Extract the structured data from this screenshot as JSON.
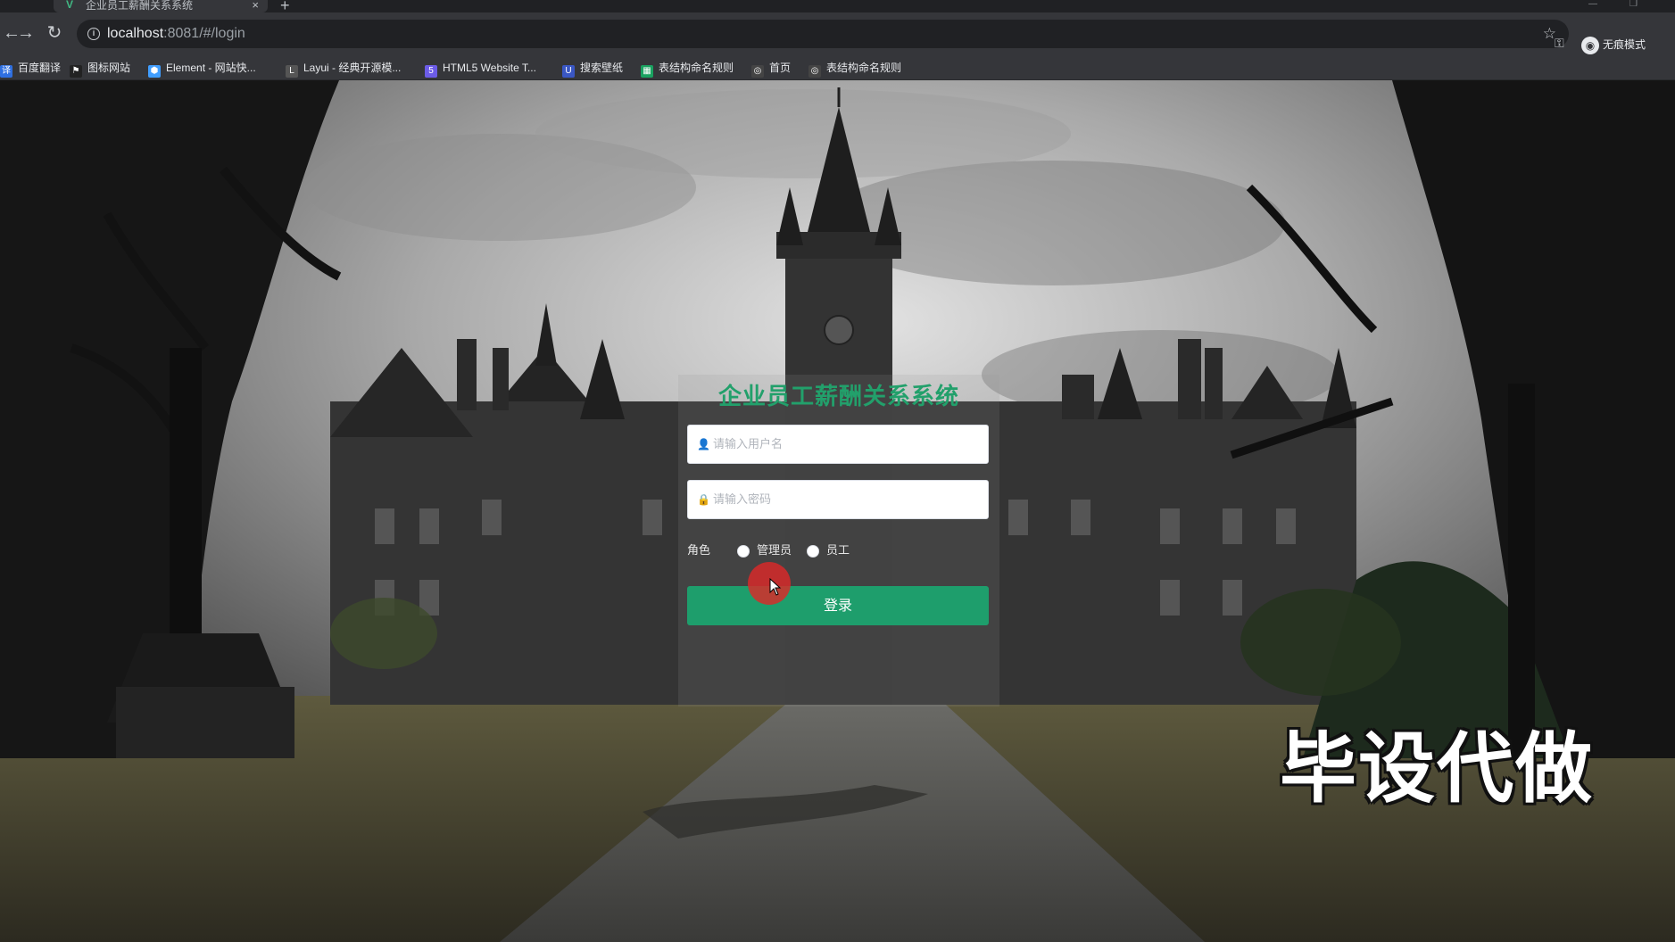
{
  "browser": {
    "tab_title": "企业员工薪酬关系系统",
    "tab_close": "×",
    "new_tab": "+",
    "url_host": "localhost",
    "url_rest": ":8081/#/login",
    "incognito_label": "无痕模式"
  },
  "bookmarks": [
    {
      "label": "百度翻译",
      "icon": "translate-icon",
      "color": "#2f6fe0"
    },
    {
      "label": "图标网站",
      "icon": "flag-icon",
      "color": "#222222"
    },
    {
      "label": "Element - 网站快...",
      "icon": "element-icon",
      "color": "#409eff"
    },
    {
      "label": "Layui - 经典开源模...",
      "icon": "layui-icon",
      "color": "#555555"
    },
    {
      "label": "HTML5 Website T...",
      "icon": "html5-icon",
      "color": "#6c5ce7"
    },
    {
      "label": "搜索壁纸",
      "icon": "wallpaper-icon",
      "color": "#3a57c4"
    },
    {
      "label": "表结构命名规则",
      "icon": "table-icon",
      "color": "#1aa260"
    },
    {
      "label": "首页",
      "icon": "globe-icon",
      "color": "#444444"
    },
    {
      "label": "表结构命名规则",
      "icon": "globe-icon",
      "color": "#444444"
    }
  ],
  "login": {
    "title": "企业员工薪酬关系系统",
    "username_placeholder": "请输入用户名",
    "password_placeholder": "请输入密码",
    "role_label": "角色",
    "roles": [
      "管理员",
      "员工"
    ],
    "submit_label": "登录"
  },
  "watermark": "毕设代做",
  "colors": {
    "accent": "#1e9e6c",
    "title": "#22a06b",
    "cursor_halo": "#dc2828"
  }
}
